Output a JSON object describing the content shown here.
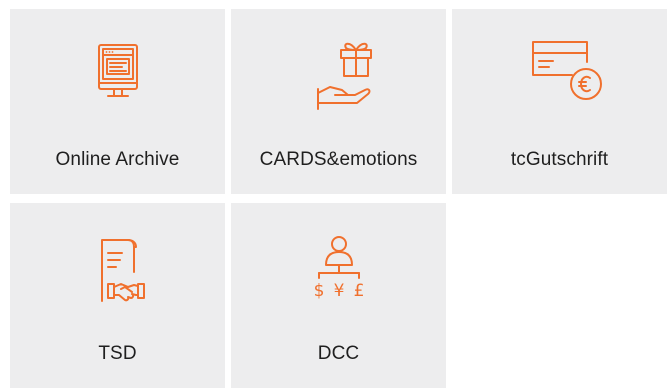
{
  "colors": {
    "tile_background": "#ededee",
    "icon_accent": "#f0702d",
    "label_text": "#1f1f1f"
  },
  "tiles": [
    {
      "label": "Online Archive",
      "icon": "monitor-archive-icon"
    },
    {
      "label": "CARDS&emotions",
      "icon": "gift-hand-icon"
    },
    {
      "label": "tcGutschrift",
      "icon": "card-euro-icon"
    },
    {
      "label": "TSD",
      "icon": "document-handshake-icon"
    },
    {
      "label": "DCC",
      "icon": "person-currency-icon"
    }
  ]
}
